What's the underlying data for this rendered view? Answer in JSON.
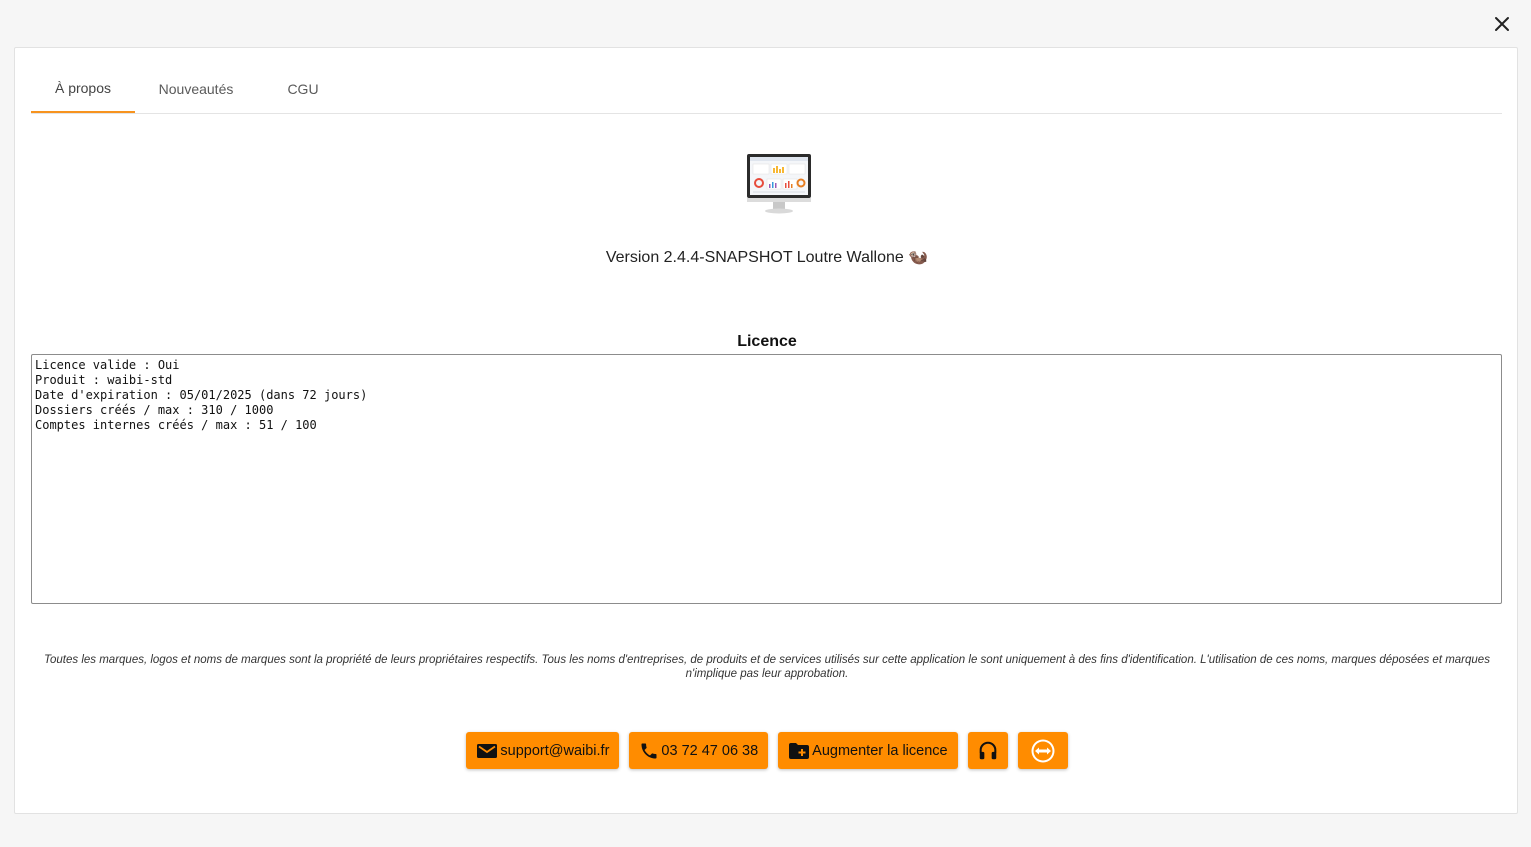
{
  "dialog": {
    "close_icon": "close-icon"
  },
  "tabs": [
    {
      "label": "À propos",
      "active": true
    },
    {
      "label": "Nouveautés",
      "active": false
    },
    {
      "label": "CGU",
      "active": false
    }
  ],
  "about": {
    "logo_icon": "monitor-dashboard-icon",
    "version": "Version 2.4.4-SNAPSHOT Loutre Wallone 🦦",
    "licence_title": "Licence",
    "licence_text": "Licence valide : Oui\nProduit : waibi-std\nDate d'expiration : 05/01/2025 (dans 72 jours)\nDossiers créés / max : 310 / 1000\nComptes internes créés / max : 51 / 100",
    "disclaimer": "Toutes les marques, logos et noms de marques sont la propriété de leurs propriétaires respectifs. Tous les noms d'entreprises, de produits et de services utilisés sur cette application le sont uniquement à des fins d'identification. L'utilisation de ces noms, marques déposées et marques n'implique pas leur approbation."
  },
  "actions": {
    "email_label": "support@waibi.fr",
    "phone_label": "03 72 47 06 38",
    "upgrade_label": "Augmenter la licence",
    "support_icon": "headset-icon",
    "remote_icon": "teamviewer-icon"
  },
  "colors": {
    "accent": "#ff8c00",
    "tab_indicator": "#f7931e"
  }
}
